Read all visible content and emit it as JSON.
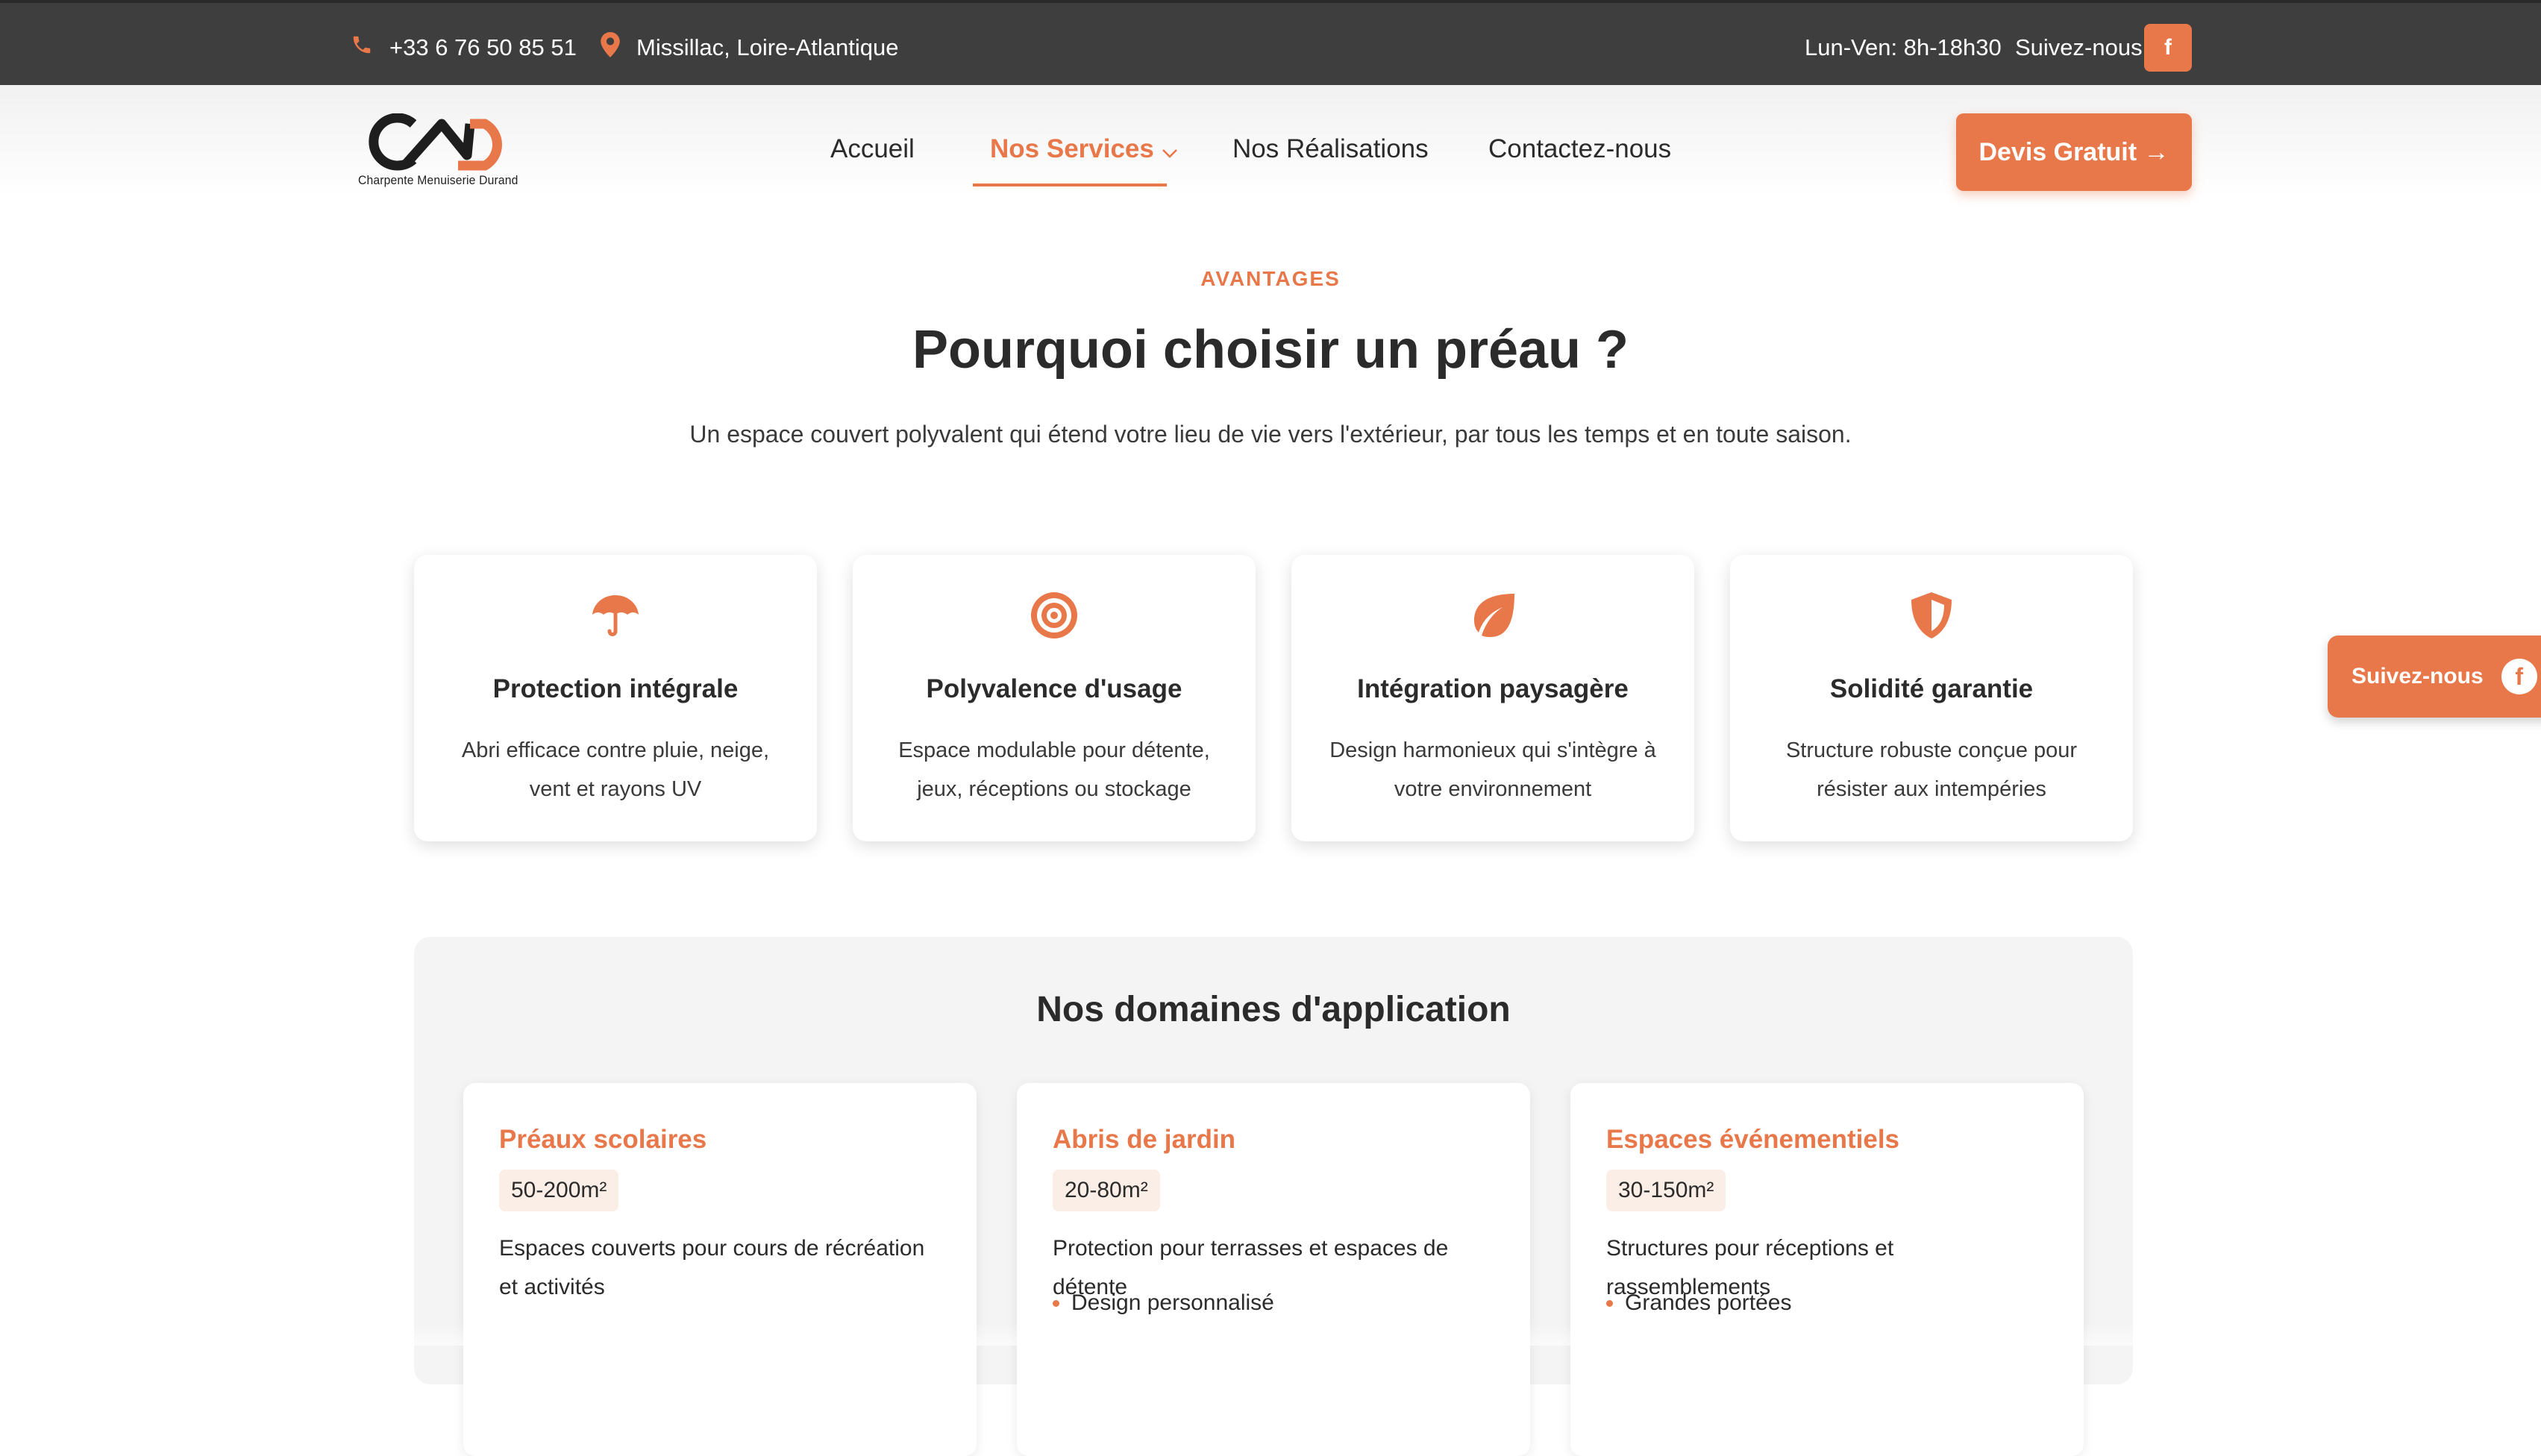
{
  "topbar": {
    "phone": "+33 6 76 50 85 51",
    "location": "Missillac, Loire-Atlantique",
    "hours": "Lun-Ven: 8h-18h30",
    "follow": "Suivez-nous",
    "facebook_glyph": "f",
    "icons": [
      "phone-icon",
      "map-pin-icon",
      "facebook-icon"
    ]
  },
  "header": {
    "logo_subtitle": "Charpente Menuiserie Durand",
    "nav": {
      "accueil": "Accueil",
      "services": "Nos Services",
      "realisations": "Nos Réalisations",
      "contact": "Contactez-nous"
    },
    "cta": "Devis Gratuit →"
  },
  "avantages": {
    "eyebrow": "AVANTAGES",
    "title": "Pourquoi choisir un préau ?",
    "subtitle": "Un espace couvert polyvalent qui étend votre lieu de vie vers l'extérieur, par tous les temps et en toute saison.",
    "features": [
      {
        "icon": "umbrella-icon",
        "title": "Protection intégrale",
        "text": "Abri efficace contre pluie, neige, vent et rayons UV"
      },
      {
        "icon": "target-icon",
        "title": "Polyvalence d'usage",
        "text": "Espace modulable pour détente, jeux, réceptions ou stockage"
      },
      {
        "icon": "leaf-icon",
        "title": "Intégration paysagère",
        "text": "Design harmonieux qui s'intègre à votre environnement"
      },
      {
        "icon": "shield-icon",
        "title": "Solidité garantie",
        "text": "Structure robuste conçue pour résister aux intempéries"
      }
    ]
  },
  "floating": {
    "follow": "Suivez-nous",
    "facebook_glyph": "f"
  },
  "domaines": {
    "title": "Nos domaines d'application",
    "cards": [
      {
        "title": "Préaux scolaires",
        "size": "50-200m²",
        "text": "Espaces couverts pour cours de récréation et activités",
        "bullet": ""
      },
      {
        "title": "Abris de jardin",
        "size": "20-80m²",
        "text": "Protection pour terrasses et espaces de détente",
        "bullet": "Design personnalisé"
      },
      {
        "title": "Espaces événementiels",
        "size": "30-150m²",
        "text": "Structures pour réceptions et rassemblements",
        "bullet": "Grandes portées"
      }
    ]
  },
  "colors": {
    "accent": "#e8784a",
    "topbar": "#3e3e3e",
    "text": "#2b2b2b",
    "panel": "#f4f4f4"
  }
}
